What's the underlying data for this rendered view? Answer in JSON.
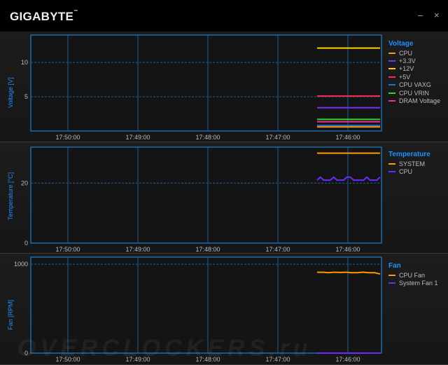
{
  "app": {
    "title": "GIGABYTE",
    "tm": "™",
    "minimize": "–",
    "close": "×"
  },
  "time_labels": [
    "17:50:00",
    "17:49:00",
    "17:48:00",
    "17:47:00",
    "17:46:00"
  ],
  "watermark": "OVERCLOCKERS.ru",
  "charts": [
    {
      "id": "voltage",
      "title": "Voltage",
      "ylabel": "Voltage [V]",
      "ylim": [
        0,
        14
      ],
      "yticks": [
        {
          "v": 5,
          "label": "5"
        },
        {
          "v": 10,
          "label": "10"
        }
      ],
      "series": [
        {
          "name": "CPU",
          "color": "#ff9900",
          "values": [
            0.6,
            0.6,
            0.6,
            0.6,
            0.6,
            0.6,
            0.6,
            0.6,
            0.6,
            0.6
          ]
        },
        {
          "name": "+3.3V",
          "color": "#7a2cff",
          "values": [
            3.4,
            3.4,
            3.4,
            3.4,
            3.4,
            3.4,
            3.4,
            3.4,
            3.4,
            3.4
          ]
        },
        {
          "name": "+12V",
          "color": "#ffd000",
          "values": [
            12.1,
            12.1,
            12.1,
            12.1,
            12.1,
            12.1,
            12.1,
            12.1,
            12.1,
            12.1
          ]
        },
        {
          "name": "+5V",
          "color": "#ff2a55",
          "values": [
            5.1,
            5.1,
            5.1,
            5.1,
            5.1,
            5.1,
            5.1,
            5.1,
            5.1,
            5.1
          ]
        },
        {
          "name": "CPU VAXG",
          "color": "#1e6fd9",
          "values": [
            0.8,
            0.8,
            0.8,
            0.8,
            0.8,
            0.8,
            0.8,
            0.8,
            0.8,
            0.8
          ]
        },
        {
          "name": "CPU VRIN",
          "color": "#22dd22",
          "values": [
            1.7,
            1.7,
            1.7,
            1.7,
            1.7,
            1.7,
            1.7,
            1.7,
            1.7,
            1.7
          ]
        },
        {
          "name": "DRAM Voltage",
          "color": "#ff22aa",
          "values": [
            1.35,
            1.35,
            1.35,
            1.35,
            1.35,
            1.35,
            1.35,
            1.35,
            1.35,
            1.35
          ]
        }
      ]
    },
    {
      "id": "temperature",
      "title": "Temperature",
      "ylabel": "Temperature [°C]",
      "ylim": [
        0,
        32
      ],
      "yticks": [
        {
          "v": 0,
          "label": "0"
        },
        {
          "v": 20,
          "label": "20"
        }
      ],
      "series": [
        {
          "name": "SYSTEM",
          "color": "#ff9900",
          "values": [
            30,
            30,
            30,
            30,
            30,
            30,
            30,
            30,
            30,
            30,
            30,
            30,
            30,
            30,
            30,
            30,
            30,
            30,
            30,
            30
          ]
        },
        {
          "name": "CPU",
          "color": "#6a2cff",
          "values": [
            21,
            22,
            21,
            21,
            21,
            22,
            21,
            21,
            21,
            22,
            22,
            21,
            21,
            21,
            21,
            22,
            21,
            21,
            21,
            22
          ]
        }
      ]
    },
    {
      "id": "fan",
      "title": "Fan",
      "ylabel": "Fan [RPM]",
      "ylim": [
        0,
        1080
      ],
      "yticks": [
        {
          "v": 0,
          "label": "0"
        },
        {
          "v": 1000,
          "label": "1000"
        }
      ],
      "series": [
        {
          "name": "CPU Fan",
          "color": "#ff9900",
          "values": [
            910,
            910,
            905,
            910,
            908,
            910,
            905,
            905,
            910,
            905,
            905,
            890
          ]
        },
        {
          "name": "System Fan 1",
          "color": "#6a2cff",
          "values": [
            0,
            0,
            0,
            0,
            0,
            0,
            0,
            0,
            0,
            0,
            0,
            0
          ]
        }
      ]
    }
  ]
}
